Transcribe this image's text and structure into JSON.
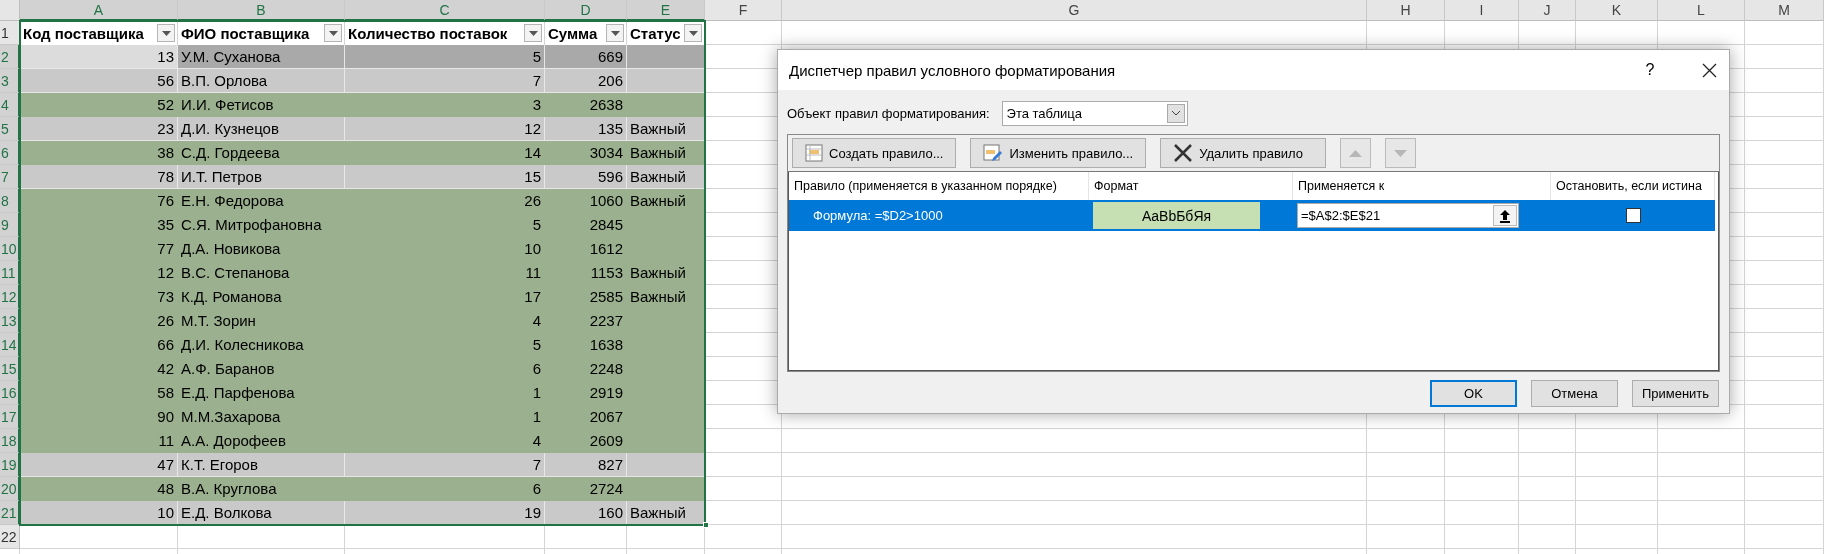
{
  "sheet": {
    "columns": [
      {
        "label": "A",
        "selected": true
      },
      {
        "label": "B",
        "selected": true
      },
      {
        "label": "C",
        "selected": true
      },
      {
        "label": "D",
        "selected": true
      },
      {
        "label": "E",
        "selected": true
      },
      {
        "label": "F",
        "selected": false
      },
      {
        "label": "G",
        "selected": false
      },
      {
        "label": "H",
        "selected": false
      },
      {
        "label": "I",
        "selected": false
      },
      {
        "label": "J",
        "selected": false
      },
      {
        "label": "K",
        "selected": false
      },
      {
        "label": "L",
        "selected": false
      },
      {
        "label": "M",
        "selected": false
      }
    ],
    "row_numbers": [
      {
        "label": "1",
        "selected": false
      },
      {
        "label": "2",
        "selected": true
      },
      {
        "label": "3",
        "selected": true
      },
      {
        "label": "4",
        "selected": true
      },
      {
        "label": "5",
        "selected": true
      },
      {
        "label": "6",
        "selected": true
      },
      {
        "label": "7",
        "selected": true
      },
      {
        "label": "8",
        "selected": true
      },
      {
        "label": "9",
        "selected": true
      },
      {
        "label": "10",
        "selected": true
      },
      {
        "label": "11",
        "selected": true
      },
      {
        "label": "12",
        "selected": true
      },
      {
        "label": "13",
        "selected": true
      },
      {
        "label": "14",
        "selected": true
      },
      {
        "label": "15",
        "selected": true
      },
      {
        "label": "16",
        "selected": true
      },
      {
        "label": "17",
        "selected": true
      },
      {
        "label": "18",
        "selected": true
      },
      {
        "label": "19",
        "selected": true
      },
      {
        "label": "20",
        "selected": true
      },
      {
        "label": "21",
        "selected": true
      },
      {
        "label": "22",
        "selected": false
      }
    ],
    "table": {
      "headers": [
        "Код поставщика",
        "ФИО поставщика",
        "Количество поставок",
        "Сумма",
        "Статус"
      ],
      "rows": [
        {
          "kind": "active",
          "cells": [
            "13",
            "У.М. Суханова",
            "5",
            "669"
          ]
        },
        {
          "kind": "plain",
          "cells": [
            "56",
            "В.П. Орлова",
            "7",
            "206"
          ]
        },
        {
          "kind": "match",
          "cells": [
            "52",
            "И.И. Фетисов",
            "3",
            "2638"
          ]
        },
        {
          "kind": "plain",
          "cells": [
            "23",
            "Д.И. Кузнецов",
            "12",
            "135",
            "Важный"
          ]
        },
        {
          "kind": "match",
          "cells": [
            "38",
            "С.Д. Гордеева",
            "14",
            "3034",
            "Важный"
          ]
        },
        {
          "kind": "plain",
          "cells": [
            "78",
            "И.Т. Петров",
            "15",
            "596",
            "Важный"
          ]
        },
        {
          "kind": "match",
          "cells": [
            "76",
            "Е.Н. Федорова",
            "26",
            "1060",
            "Важный"
          ]
        },
        {
          "kind": "match",
          "cells": [
            "35",
            "С.Я. Митрофановна",
            "5",
            "2845"
          ]
        },
        {
          "kind": "match",
          "cells": [
            "77",
            "Д.А. Новикова",
            "10",
            "1612"
          ]
        },
        {
          "kind": "match",
          "cells": [
            "12",
            "В.С. Степанова",
            "11",
            "1153",
            "Важный"
          ]
        },
        {
          "kind": "match",
          "cells": [
            "73",
            "К.Д. Романова",
            "17",
            "2585",
            "Важный"
          ]
        },
        {
          "kind": "match",
          "cells": [
            "26",
            "М.Т. Зорин",
            "4",
            "2237"
          ]
        },
        {
          "kind": "match",
          "cells": [
            "66",
            "Д.И. Колесникова",
            "5",
            "1638"
          ]
        },
        {
          "kind": "match",
          "cells": [
            "42",
            "А.Ф. Баранов",
            "6",
            "2248"
          ]
        },
        {
          "kind": "match",
          "cells": [
            "58",
            "Е.Д. Парфенова",
            "1",
            "2919"
          ]
        },
        {
          "kind": "match",
          "cells": [
            "90",
            "М.М.Захарова",
            "1",
            "2067"
          ]
        },
        {
          "kind": "match",
          "cells": [
            "11",
            "А.А. Дорофеев",
            "4",
            "2609"
          ]
        },
        {
          "kind": "plain",
          "cells": [
            "47",
            "К.Т. Егоров",
            "7",
            "827"
          ]
        },
        {
          "kind": "match",
          "cells": [
            "48",
            "В.А. Круглова",
            "6",
            "2724"
          ]
        },
        {
          "kind": "plain",
          "cells": [
            "10",
            "Е.Д. Волкова",
            "19",
            "160",
            "Важный"
          ]
        }
      ]
    }
  },
  "dialog": {
    "title": "Диспетчер правил условного форматирования",
    "help": "?",
    "scope_label": "Объект правил форматирования:",
    "scope_value": "Эта таблица",
    "toolbar": [
      {
        "kind": "new",
        "label": "Создать правило..."
      },
      {
        "kind": "edit",
        "label": "Изменить правило..."
      },
      {
        "kind": "delete",
        "label": "Удалить правило"
      },
      {
        "kind": "up",
        "disabled": true
      },
      {
        "kind": "down",
        "disabled": true
      }
    ],
    "columns": [
      "Правило (применяется в указанном порядке)",
      "Формат",
      "Применяется к",
      "Остановить, если истина"
    ],
    "rules": [
      {
        "rule": "Формула: =$D2>1000",
        "format_sample": "AaBbБбЯя",
        "applies_to": "=$A$2:$E$21",
        "stop_if_true": false,
        "selected": true
      }
    ],
    "buttons": [
      {
        "label": "OK",
        "default": true
      },
      {
        "label": "Отмена",
        "default": false
      },
      {
        "label": "Применить",
        "default": false
      }
    ]
  }
}
